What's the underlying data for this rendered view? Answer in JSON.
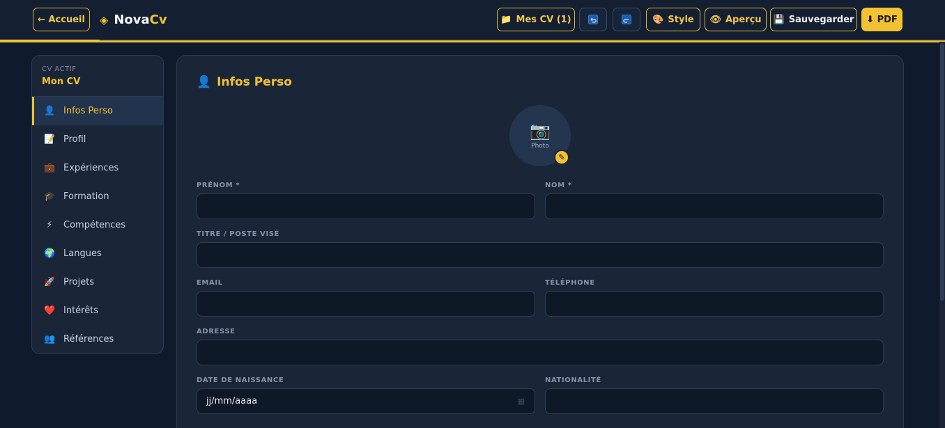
{
  "header": {
    "back_label": "← Accueil",
    "brand_prefix": "Nova",
    "brand_suffix": "Cv",
    "my_cv_label": "Mes CV (1)",
    "style_label": "Style",
    "preview_label": "Aperçu",
    "save_label": "Sauvegarder",
    "pdf_label": "⬇ PDF"
  },
  "sidebar": {
    "cv_label": "CV ACTIF",
    "cv_name": "Mon CV",
    "items": [
      {
        "icon": "👤",
        "label": "Infos Perso"
      },
      {
        "icon": "📝",
        "label": "Profil"
      },
      {
        "icon": "💼",
        "label": "Expériences"
      },
      {
        "icon": "🎓",
        "label": "Formation"
      },
      {
        "icon": "⚡",
        "label": "Compétences"
      },
      {
        "icon": "🌍",
        "label": "Langues"
      },
      {
        "icon": "🚀",
        "label": "Projets"
      },
      {
        "icon": "❤️",
        "label": "Intérêts"
      },
      {
        "icon": "👥",
        "label": "Références"
      }
    ]
  },
  "main": {
    "title_icon": "👤",
    "title": "Infos Perso",
    "photo_label": "Photo",
    "fields": {
      "prenom": {
        "label": "PRÉNOM *",
        "value": ""
      },
      "nom": {
        "label": "NOM *",
        "value": ""
      },
      "titre": {
        "label": "TITRE / POSTE VISÉ",
        "value": ""
      },
      "email": {
        "label": "EMAIL",
        "value": ""
      },
      "telephone": {
        "label": "TÉLÉPHONE",
        "value": ""
      },
      "adresse": {
        "label": "ADRESSE",
        "value": ""
      },
      "naissance": {
        "label": "DATE DE NAISSANCE",
        "value": "jj/mm/aaaa"
      },
      "nationalite": {
        "label": "NATIONALITÉ",
        "value": ""
      }
    }
  },
  "colors": {
    "accent": "#f2c233",
    "background": "#0f1a2c",
    "panel": "#1a2638"
  }
}
